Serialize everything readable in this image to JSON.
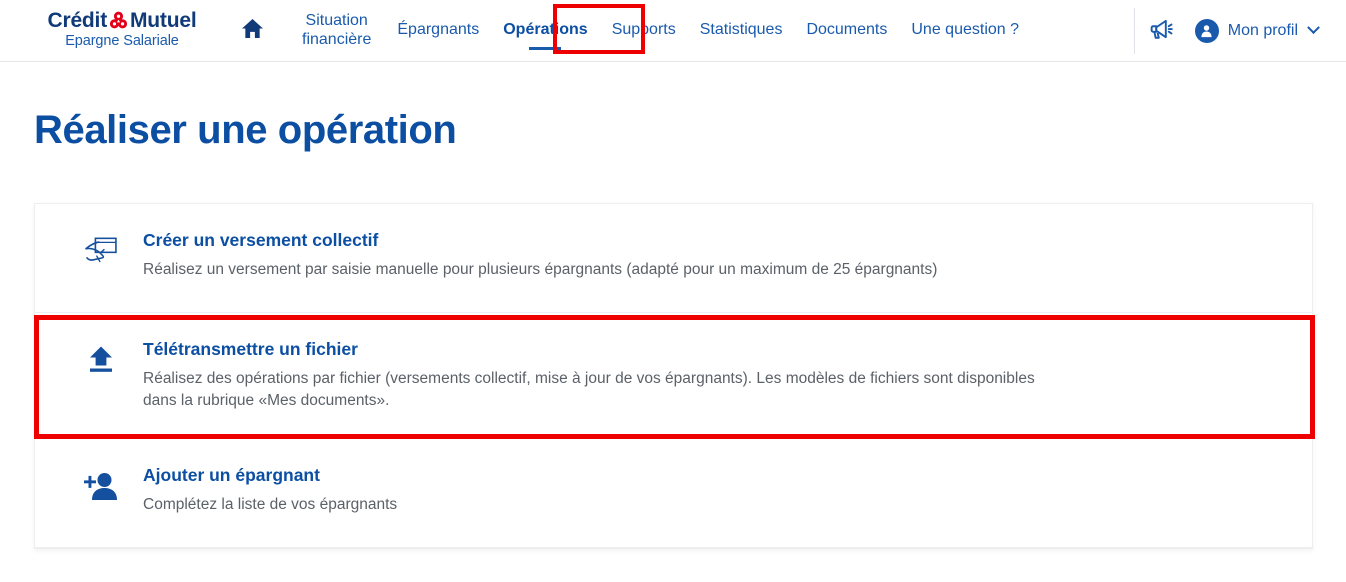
{
  "brand": {
    "name_line1_part1": "Crédit",
    "name_line1_part2": "Mutuel",
    "name_line2": "Epargne Salariale",
    "blue": "#103a78",
    "red": "#e2001a"
  },
  "header": {
    "home_icon": "home-icon",
    "nav_items": [
      {
        "label": "Situation\nfinancière",
        "name": "situation-financiere",
        "active": false,
        "two_line": true
      },
      {
        "label": "Épargnants",
        "name": "epargnants",
        "active": false,
        "two_line": false
      },
      {
        "label": "Opérations",
        "name": "operations",
        "active": true,
        "two_line": false
      },
      {
        "label": "Supports",
        "name": "supports",
        "active": false,
        "two_line": false
      },
      {
        "label": "Statistiques",
        "name": "statistiques",
        "active": false,
        "two_line": false
      },
      {
        "label": "Documents",
        "name": "documents",
        "active": false,
        "two_line": false
      },
      {
        "label": "Une question ?",
        "name": "une-question",
        "active": false,
        "two_line": false
      }
    ],
    "announcement_icon": "megaphone-icon",
    "profile_label": "Mon profil",
    "profile_icon": "user-avatar-icon",
    "profile_chevron": "chevron-down-icon",
    "accent_blue": "#1a5aad",
    "highlight_red": "#ee0000"
  },
  "main": {
    "title": "Réaliser une opération",
    "cards": [
      {
        "name": "creer-un-versement-collectif",
        "icon": "hand-writing-card-icon",
        "title": "Créer un versement collectif",
        "description": "Réalisez un versement par saisie manuelle pour plusieurs épargnants (adapté pour un maximum de 25 épargnants)",
        "highlighted": false
      },
      {
        "name": "teletransmettre-un-fichier",
        "icon": "upload-icon",
        "title": "Télétransmettre un fichier",
        "description": "Réalisez des opérations par fichier (versements collectif, mise à jour de vos épargnants). Les modèles de fichiers sont disponibles dans la rubrique «Mes documents».",
        "highlighted": true
      },
      {
        "name": "ajouter-un-epargnant",
        "icon": "add-person-icon",
        "title": "Ajouter un épargnant",
        "description": "Complétez la liste de vos épargnants",
        "highlighted": false
      }
    ]
  }
}
